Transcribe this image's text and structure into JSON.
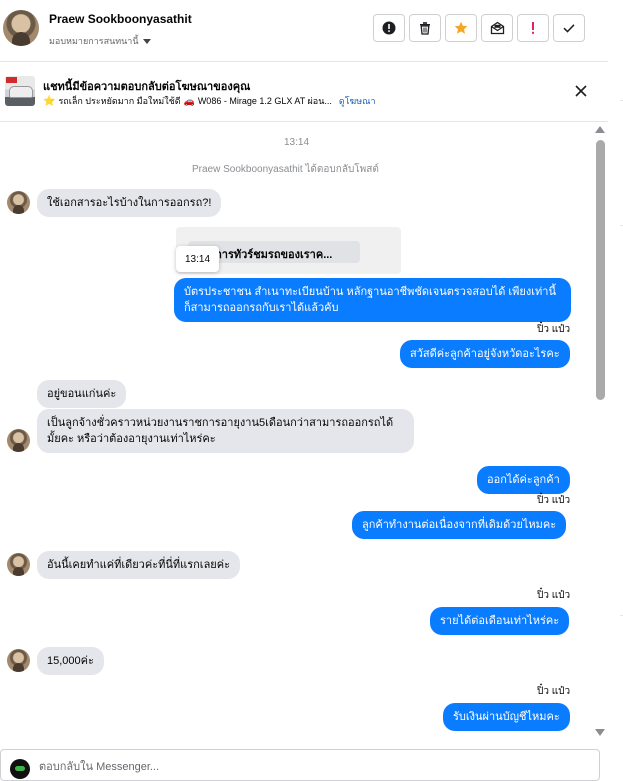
{
  "header": {
    "name": "Praew Sookboonyasathit",
    "assign_label": "มอบหมายการสนทนานี้",
    "actions": [
      {
        "name": "info-button",
        "icon": "info-circle-icon"
      },
      {
        "name": "delete-button",
        "icon": "trash-icon"
      },
      {
        "name": "star-button",
        "icon": "star-icon",
        "color": "#f5a623"
      },
      {
        "name": "mark-unread-button",
        "icon": "mail-open-icon"
      },
      {
        "name": "spam-button",
        "icon": "exclamation-icon",
        "color": "#e0245e"
      },
      {
        "name": "done-button",
        "icon": "check-icon"
      }
    ]
  },
  "ad": {
    "title": "แชทนี้มีข้อความตอบกลับต่อโฆษณาของคุณ",
    "star": "⭐",
    "subtitle": "รถเล็ก ประหยัดมาก มือใหม่ใช้ดี",
    "car_emoji": "🚗",
    "model": "W086 - Mirage 1.2 GLX AT ผ่อน...",
    "link": "ดูโฆษณา",
    "close_icon": "close-icon"
  },
  "thread": {
    "timestamp": "13:14",
    "system_note": "Praew Sookboonyasathit ได้ตอบกลับโพสต์",
    "reply_chip": "ต้องการทัวร์ชมรถของเราค...",
    "tooltip_time": "13:14",
    "messages": {
      "m1": "ใช้เอกสารอะไรบ้างในการออกรถ?!",
      "m2": "บัตรประชาชน สำเนาทะเบียนบ้าน หลักฐานอาชีพชัดเจนตรวจสอบได้ เพียงเท่านี้ก็สามารถออกรถกับเราได้แล้วคับ",
      "m3": "สวัสดีค่ะลูกค้าอยู่จังหวัดอะไรคะ",
      "m4": "อยู่ขอนแก่นค่ะ",
      "m5": "เป็นลูกจ้างชั่วคราวหน่วยงานราชการอายุงาน5เดือนกว่าสามารถออกรถได้มั้ยคะ หรือว่าต้องอายุงานเท่าไหร่คะ",
      "m6": "ออกได้ค่ะลูกค้า",
      "m7": "ลูกค้าทำงานต่อเนื่องจากที่เดิมด้วยไหมคะ",
      "m8": "อันนี้เคยทำแค่ที่เดียวค่ะที่นี่ที่แรกเลยค่ะ",
      "m9": "รายได้ต่อเดือนเท่าไหร่คะ",
      "m10": "15,000ค่ะ",
      "m11": "รับเงินผ่านบัญชีไหมคะ"
    },
    "sender_name": "ปิ๋ว แป๋ว"
  },
  "composer": {
    "placeholder": "ตอบกลับใน Messenger..."
  },
  "colors": {
    "outgoing_bubble": "#0a7cff",
    "incoming_bubble": "#e4e6eb"
  }
}
